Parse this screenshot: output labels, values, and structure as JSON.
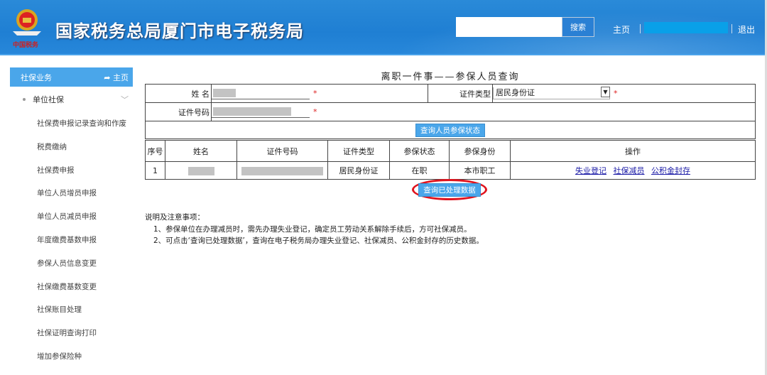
{
  "header": {
    "title": "国家税务总局厦门市电子税务局",
    "logo_text": "中国税务",
    "search_placeholder": "",
    "search_button": "搜索",
    "home": "主页",
    "logout": "退出"
  },
  "sidebar": {
    "section": "社保业务",
    "back_home": "主页",
    "group": "单位社保",
    "items": [
      "社保费申报记录查询和作废",
      "税费缴纳",
      "社保费申报",
      "单位人员增员申报",
      "单位人员减员申报",
      "年度缴费基数申报",
      "参保人员信息变更",
      "社保缴费基数变更",
      "社保账目处理",
      "社保证明查询打印",
      "增加参保险种"
    ]
  },
  "main": {
    "title": "离职一件事——参保人员查询",
    "form": {
      "name_label": "姓 名",
      "id_type_label": "证件类型",
      "id_type_value": "居民身份证",
      "id_no_label": "证件号码",
      "required_mark": "*",
      "query_button": "查询人员参保状态"
    },
    "table": {
      "headers": [
        "序号",
        "姓名",
        "证件号码",
        "证件类型",
        "参保状态",
        "参保身份",
        "操作"
      ],
      "rows": [
        {
          "no": "1",
          "id_type": "居民身份证",
          "status": "在职",
          "identity": "本市职工",
          "actions": [
            "失业登记",
            "社保减员",
            "公积金封存"
          ]
        }
      ]
    },
    "processed_button": "查询已处理数据",
    "notes": {
      "title": "说明及注意事项：",
      "lines": [
        "1、参保单位在办理减员时，需先办理失业登记，确定员工劳动关系解除手续后，方可社保减员。",
        "2、可点击‘查询已处理数据’，查询在电子税务局办理失业登记、社保减员、公积金封存的历史数据。"
      ]
    }
  },
  "colors": {
    "header_blue": "#1f7fd3",
    "accent": "#4aa6ea",
    "highlight_circle": "#e0141e",
    "link": "#1a1aa6"
  }
}
